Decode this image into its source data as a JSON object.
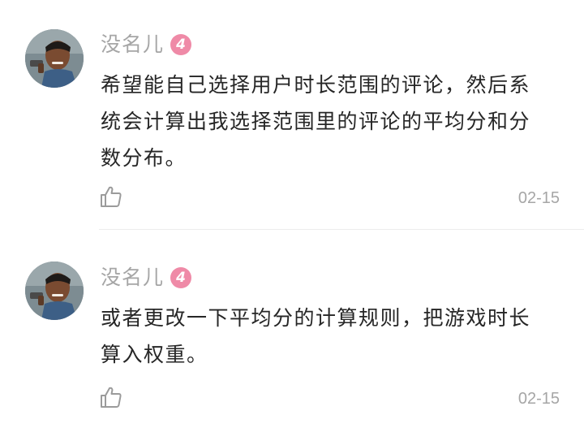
{
  "comments": [
    {
      "username": "没名儿",
      "level": "4",
      "lines": [
        "希望能自己选择用户时长范围的评论，然后系",
        "统会计算出我选择范围里的评论的平均分和分",
        "数分布。"
      ],
      "date": "02-15",
      "like_icon": "thumbs-up-icon"
    },
    {
      "username": "没名儿",
      "level": "4",
      "lines": [
        "或者更改一下平均分的计算规则，把游戏时长",
        "算入权重。"
      ],
      "date": "02-15",
      "like_icon": "thumbs-up-icon"
    }
  ],
  "colors": {
    "badge": "#ef8aa7",
    "meta_text": "#a6a6a6",
    "body_text": "#262626"
  }
}
